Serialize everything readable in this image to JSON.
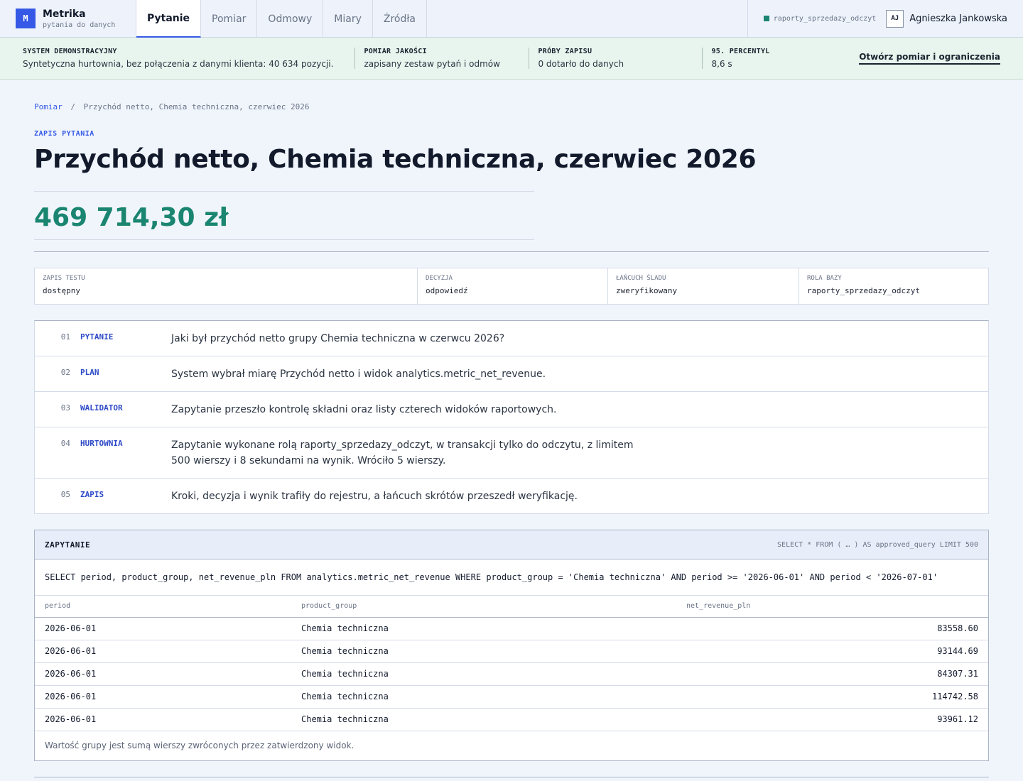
{
  "brand": {
    "logo": "M",
    "name": "Metrika",
    "subtitle": "pytania do danych"
  },
  "tabs": [
    {
      "label": "Pytanie",
      "active": true
    },
    {
      "label": "Pomiar"
    },
    {
      "label": "Odmowy"
    },
    {
      "label": "Miary"
    },
    {
      "label": "Źródła"
    }
  ],
  "user": {
    "role": "raporty_sprzedazy_odczyt",
    "initials": "AJ",
    "name": "Agnieszka Jankowska"
  },
  "banner": {
    "cells": [
      {
        "label": "SYSTEM DEMONSTRACYJNY",
        "value": "Syntetyczna hurtownia, bez połączenia z danymi klienta: 40 634 pozycji."
      },
      {
        "label": "POMIAR JAKOŚCI",
        "value": "zapisany zestaw pytań i odmów"
      },
      {
        "label": "PRÓBY ZAPISU",
        "value": "0 dotarło do danych"
      },
      {
        "label": "95. PERCENTYL",
        "value": "8,6 s"
      }
    ],
    "link": "Otwórz pomiar i ograniczenia"
  },
  "breadcrumb": {
    "root": "Pomiar",
    "separator": "/",
    "current": "Przychód netto, Chemia techniczna, czerwiec 2026"
  },
  "eyebrow": "ZAPIS PYTANIA",
  "title": "Przychód netto, Chemia techniczna, czerwiec 2026",
  "amount": "469 714,30 zł",
  "meta": [
    {
      "label": "ZAPIS TESTU",
      "value": "dostępny"
    },
    {
      "label": "DECYZJA",
      "value": "odpowiedź"
    },
    {
      "label": "ŁAŃCUCH ŚLADU",
      "value": "zweryfikowany"
    },
    {
      "label": "ROLA BAZY",
      "value": "raporty_sprzedazy_odczyt"
    }
  ],
  "steps": [
    {
      "num": "01",
      "name": "PYTANIE",
      "text": "Jaki był przychód netto grupy Chemia techniczna w czerwcu 2026?"
    },
    {
      "num": "02",
      "name": "PLAN",
      "text": "System wybrał miarę Przychód netto i widok analytics.metric_net_revenue."
    },
    {
      "num": "03",
      "name": "WALIDATOR",
      "text": "Zapytanie przeszło kontrolę składni oraz listy czterech widoków raportowych."
    },
    {
      "num": "04",
      "name": "HURTOWNIA",
      "text": "Zapytanie wykonane rolą raporty_sprzedazy_odczyt, w transakcji tylko do odczytu, z limitem 500 wierszy i 8 sekundami na wynik. Wróciło 5 wierszy."
    },
    {
      "num": "05",
      "name": "ZAPIS",
      "text": "Kroki, decyzja i wynik trafiły do rejestru, a łańcuch skrótów przeszedł weryfikację."
    }
  ],
  "query": {
    "title": "ZAPYTANIE",
    "wrapper": "SELECT * FROM ( … ) AS approved_query LIMIT 500",
    "sql": "SELECT period, product_group, net_revenue_pln FROM analytics.metric_net_revenue WHERE product_group = 'Chemia techniczna' AND period >= '2026-06-01' AND period < '2026-07-01'",
    "columns": [
      "period",
      "product_group",
      "net_revenue_pln"
    ],
    "rows": [
      [
        "2026-06-01",
        "Chemia techniczna",
        "83558.60"
      ],
      [
        "2026-06-01",
        "Chemia techniczna",
        "93144.69"
      ],
      [
        "2026-06-01",
        "Chemia techniczna",
        "84307.31"
      ],
      [
        "2026-06-01",
        "Chemia techniczna",
        "114742.58"
      ],
      [
        "2026-06-01",
        "Chemia techniczna",
        "93961.12"
      ]
    ],
    "footnote": "Wartość grupy jest sumą wierszy zwróconych przez zatwierdzony widok."
  },
  "colors": {
    "accent": "#3559e6",
    "success": "#1a8570",
    "banner_bg": "#e8f5ee"
  }
}
